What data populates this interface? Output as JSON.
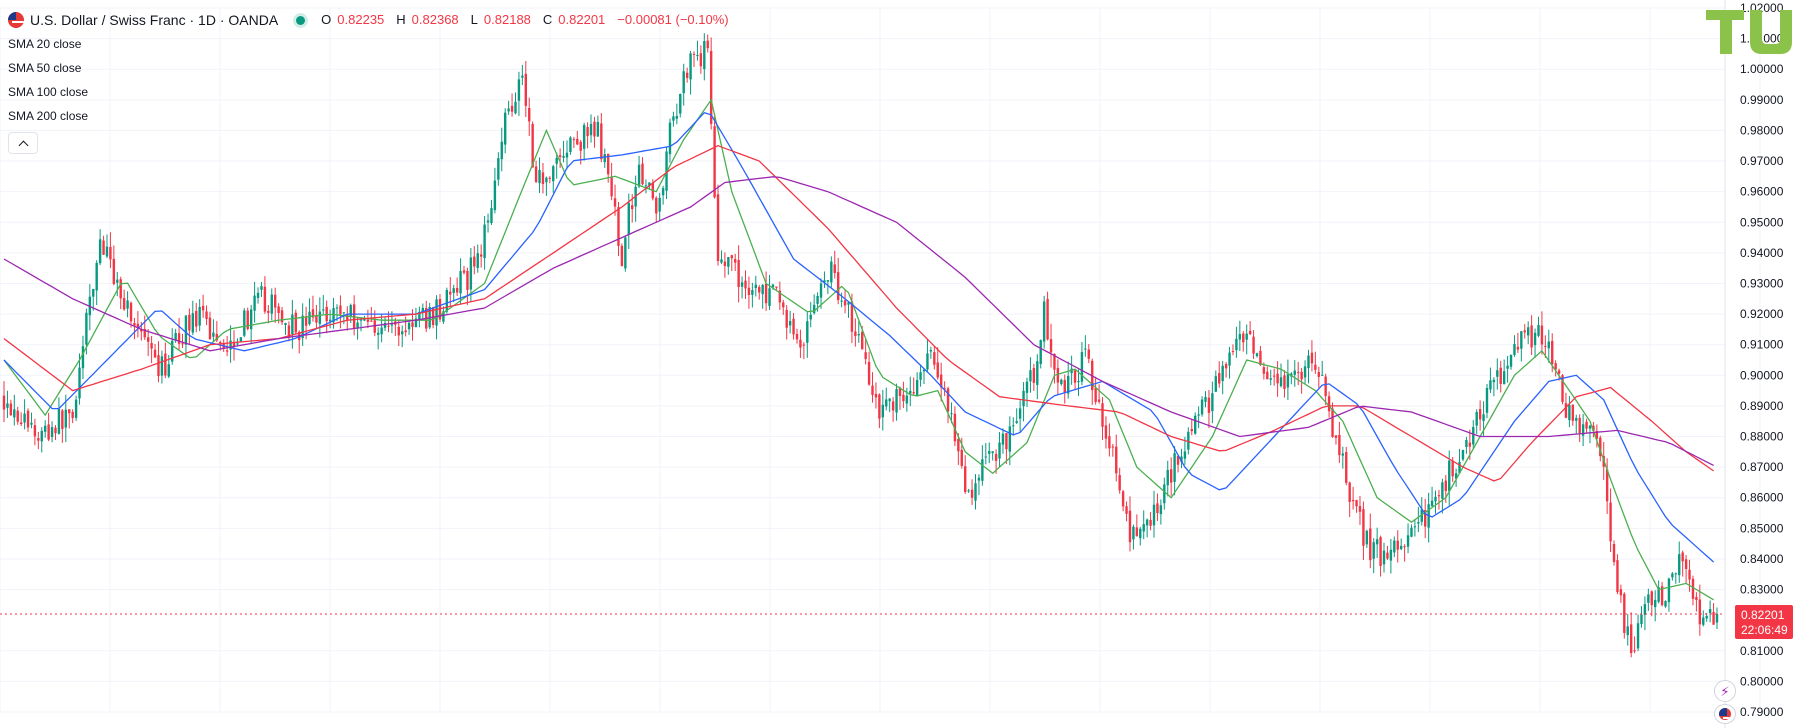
{
  "legend": {
    "title": "U.S. Dollar / Swiss Franc · 1D · OANDA",
    "ohlc": {
      "o_label": "O",
      "o": "0.82235",
      "h_label": "H",
      "h": "0.82368",
      "l_label": "L",
      "l": "0.82188",
      "c_label": "C",
      "c": "0.82201",
      "change": "−0.00081 (−0.10%)"
    },
    "indicators": [
      "SMA 20 close",
      "SMA 50 close",
      "SMA 100 close",
      "SMA 200 close"
    ]
  },
  "price_tag": {
    "price": "0.82201",
    "countdown": "22:06:49"
  },
  "icons": {
    "flag": "usd-chf-flag-icon",
    "collapse": "chevron-up-icon",
    "logo": "tu-logo",
    "alert": "lightning-icon",
    "flag_small": "flag-icon"
  },
  "colors": {
    "up": "#089981",
    "down": "#f23645",
    "sma20": "#4caf50",
    "sma50": "#2962ff",
    "sma100": "#f23645",
    "sma200": "#9c27b0",
    "logo": "#8bc34a"
  },
  "chart_data": {
    "type": "line",
    "subtype": "candlestick-with-moving-averages",
    "title": "U.S. Dollar / Swiss Franc · 1D · OANDA",
    "ylim": [
      0.79,
      1.02
    ],
    "y_ticks": [
      1.02,
      1.01,
      1.0,
      0.99,
      0.98,
      0.97,
      0.96,
      0.95,
      0.94,
      0.93,
      0.92,
      0.91,
      0.9,
      0.89,
      0.88,
      0.87,
      0.86,
      0.85,
      0.84,
      0.83,
      0.81,
      0.8,
      0.79
    ],
    "y_tick_labels": [
      "1.02000",
      "1.01000",
      "1.00000",
      "0.99000",
      "0.98000",
      "0.97000",
      "0.96000",
      "0.95000",
      "0.94000",
      "0.93000",
      "0.92000",
      "0.91000",
      "0.90000",
      "0.89000",
      "0.88000",
      "0.87000",
      "0.86000",
      "0.85000",
      "0.84000",
      "0.83000",
      "0.81000",
      "0.80000",
      "0.79000"
    ],
    "grid": true,
    "x_points": 500,
    "last_price": 0.82201,
    "price_path": [
      [
        0,
        0.893
      ],
      [
        10,
        0.88
      ],
      [
        20,
        0.888
      ],
      [
        28,
        0.944
      ],
      [
        35,
        0.925
      ],
      [
        45,
        0.9
      ],
      [
        55,
        0.92
      ],
      [
        65,
        0.91
      ],
      [
        75,
        0.925
      ],
      [
        85,
        0.915
      ],
      [
        95,
        0.922
      ],
      [
        105,
        0.918
      ],
      [
        115,
        0.915
      ],
      [
        125,
        0.92
      ],
      [
        135,
        0.932
      ],
      [
        140,
        0.945
      ],
      [
        145,
        0.98
      ],
      [
        151,
        1.0
      ],
      [
        155,
        0.963
      ],
      [
        165,
        0.975
      ],
      [
        173,
        0.98
      ],
      [
        180,
        0.94
      ],
      [
        185,
        0.97
      ],
      [
        190,
        0.952
      ],
      [
        195,
        0.985
      ],
      [
        200,
        1.005
      ],
      [
        205,
        1.005
      ],
      [
        208,
        0.94
      ],
      [
        215,
        0.93
      ],
      [
        225,
        0.925
      ],
      [
        232,
        0.91
      ],
      [
        240,
        0.935
      ],
      [
        245,
        0.925
      ],
      [
        255,
        0.89
      ],
      [
        265,
        0.895
      ],
      [
        270,
        0.905
      ],
      [
        275,
        0.892
      ],
      [
        280,
        0.86
      ],
      [
        285,
        0.87
      ],
      [
        292,
        0.88
      ],
      [
        300,
        0.9
      ],
      [
        303,
        0.92
      ],
      [
        308,
        0.895
      ],
      [
        315,
        0.905
      ],
      [
        322,
        0.88
      ],
      [
        328,
        0.845
      ],
      [
        335,
        0.855
      ],
      [
        342,
        0.875
      ],
      [
        350,
        0.89
      ],
      [
        357,
        0.905
      ],
      [
        362,
        0.912
      ],
      [
        368,
        0.895
      ],
      [
        375,
        0.898
      ],
      [
        382,
        0.905
      ],
      [
        390,
        0.87
      ],
      [
        397,
        0.845
      ],
      [
        402,
        0.84
      ],
      [
        412,
        0.85
      ],
      [
        418,
        0.862
      ],
      [
        425,
        0.876
      ],
      [
        432,
        0.893
      ],
      [
        438,
        0.905
      ],
      [
        443,
        0.915
      ],
      [
        450,
        0.91
      ],
      [
        455,
        0.888
      ],
      [
        460,
        0.88
      ],
      [
        465,
        0.878
      ],
      [
        470,
        0.83
      ],
      [
        474,
        0.808
      ],
      [
        478,
        0.826
      ],
      [
        484,
        0.828
      ],
      [
        488,
        0.84
      ],
      [
        494,
        0.823
      ],
      [
        499,
        0.822
      ]
    ],
    "series": [
      {
        "name": "SMA 20 close",
        "points": [
          [
            0,
            0.905
          ],
          [
            12,
            0.887
          ],
          [
            22,
            0.905
          ],
          [
            35,
            0.932
          ],
          [
            45,
            0.913
          ],
          [
            55,
            0.905
          ],
          [
            65,
            0.915
          ],
          [
            80,
            0.918
          ],
          [
            95,
            0.92
          ],
          [
            110,
            0.918
          ],
          [
            125,
            0.918
          ],
          [
            140,
            0.93
          ],
          [
            150,
            0.958
          ],
          [
            158,
            0.98
          ],
          [
            165,
            0.962
          ],
          [
            178,
            0.965
          ],
          [
            190,
            0.96
          ],
          [
            198,
            0.977
          ],
          [
            206,
            0.99
          ],
          [
            212,
            0.96
          ],
          [
            222,
            0.93
          ],
          [
            235,
            0.92
          ],
          [
            245,
            0.93
          ],
          [
            255,
            0.9
          ],
          [
            265,
            0.893
          ],
          [
            272,
            0.895
          ],
          [
            280,
            0.875
          ],
          [
            288,
            0.868
          ],
          [
            298,
            0.878
          ],
          [
            306,
            0.9
          ],
          [
            312,
            0.902
          ],
          [
            322,
            0.892
          ],
          [
            330,
            0.87
          ],
          [
            340,
            0.86
          ],
          [
            352,
            0.88
          ],
          [
            362,
            0.905
          ],
          [
            372,
            0.902
          ],
          [
            382,
            0.895
          ],
          [
            390,
            0.885
          ],
          [
            400,
            0.86
          ],
          [
            410,
            0.852
          ],
          [
            420,
            0.86
          ],
          [
            430,
            0.88
          ],
          [
            440,
            0.9
          ],
          [
            448,
            0.908
          ],
          [
            456,
            0.895
          ],
          [
            462,
            0.885
          ],
          [
            468,
            0.866
          ],
          [
            475,
            0.845
          ],
          [
            482,
            0.83
          ],
          [
            490,
            0.832
          ],
          [
            499,
            0.826
          ]
        ]
      },
      {
        "name": "SMA 50 close",
        "points": [
          [
            0,
            0.905
          ],
          [
            15,
            0.888
          ],
          [
            30,
            0.905
          ],
          [
            45,
            0.922
          ],
          [
            55,
            0.912
          ],
          [
            70,
            0.908
          ],
          [
            85,
            0.912
          ],
          [
            100,
            0.92
          ],
          [
            120,
            0.92
          ],
          [
            140,
            0.928
          ],
          [
            155,
            0.948
          ],
          [
            165,
            0.97
          ],
          [
            180,
            0.972
          ],
          [
            195,
            0.975
          ],
          [
            205,
            0.987
          ],
          [
            215,
            0.968
          ],
          [
            230,
            0.938
          ],
          [
            245,
            0.925
          ],
          [
            258,
            0.913
          ],
          [
            270,
            0.9
          ],
          [
            280,
            0.888
          ],
          [
            295,
            0.88
          ],
          [
            305,
            0.893
          ],
          [
            320,
            0.898
          ],
          [
            335,
            0.888
          ],
          [
            345,
            0.868
          ],
          [
            355,
            0.862
          ],
          [
            370,
            0.88
          ],
          [
            385,
            0.898
          ],
          [
            395,
            0.89
          ],
          [
            405,
            0.87
          ],
          [
            415,
            0.853
          ],
          [
            425,
            0.86
          ],
          [
            440,
            0.885
          ],
          [
            450,
            0.898
          ],
          [
            458,
            0.9
          ],
          [
            466,
            0.892
          ],
          [
            475,
            0.87
          ],
          [
            485,
            0.852
          ],
          [
            499,
            0.838
          ]
        ]
      },
      {
        "name": "SMA 100 close",
        "points": [
          [
            0,
            0.912
          ],
          [
            20,
            0.895
          ],
          [
            40,
            0.902
          ],
          [
            60,
            0.91
          ],
          [
            80,
            0.912
          ],
          [
            100,
            0.918
          ],
          [
            120,
            0.92
          ],
          [
            140,
            0.925
          ],
          [
            160,
            0.94
          ],
          [
            180,
            0.955
          ],
          [
            195,
            0.968
          ],
          [
            208,
            0.975
          ],
          [
            220,
            0.97
          ],
          [
            240,
            0.948
          ],
          [
            260,
            0.922
          ],
          [
            275,
            0.905
          ],
          [
            290,
            0.893
          ],
          [
            310,
            0.89
          ],
          [
            325,
            0.888
          ],
          [
            340,
            0.88
          ],
          [
            355,
            0.875
          ],
          [
            370,
            0.882
          ],
          [
            385,
            0.89
          ],
          [
            395,
            0.89
          ],
          [
            410,
            0.88
          ],
          [
            425,
            0.87
          ],
          [
            435,
            0.865
          ],
          [
            445,
            0.878
          ],
          [
            458,
            0.893
          ],
          [
            468,
            0.896
          ],
          [
            480,
            0.885
          ],
          [
            490,
            0.875
          ],
          [
            499,
            0.868
          ]
        ]
      },
      {
        "name": "SMA 200 close",
        "points": [
          [
            0,
            0.938
          ],
          [
            20,
            0.925
          ],
          [
            40,
            0.915
          ],
          [
            60,
            0.908
          ],
          [
            80,
            0.912
          ],
          [
            100,
            0.915
          ],
          [
            120,
            0.918
          ],
          [
            140,
            0.922
          ],
          [
            160,
            0.935
          ],
          [
            180,
            0.945
          ],
          [
            200,
            0.955
          ],
          [
            210,
            0.963
          ],
          [
            225,
            0.965
          ],
          [
            240,
            0.96
          ],
          [
            260,
            0.95
          ],
          [
            280,
            0.932
          ],
          [
            300,
            0.91
          ],
          [
            320,
            0.898
          ],
          [
            340,
            0.888
          ],
          [
            360,
            0.88
          ],
          [
            380,
            0.883
          ],
          [
            395,
            0.89
          ],
          [
            410,
            0.888
          ],
          [
            430,
            0.88
          ],
          [
            450,
            0.88
          ],
          [
            470,
            0.882
          ],
          [
            485,
            0.878
          ],
          [
            499,
            0.87
          ]
        ]
      }
    ]
  }
}
